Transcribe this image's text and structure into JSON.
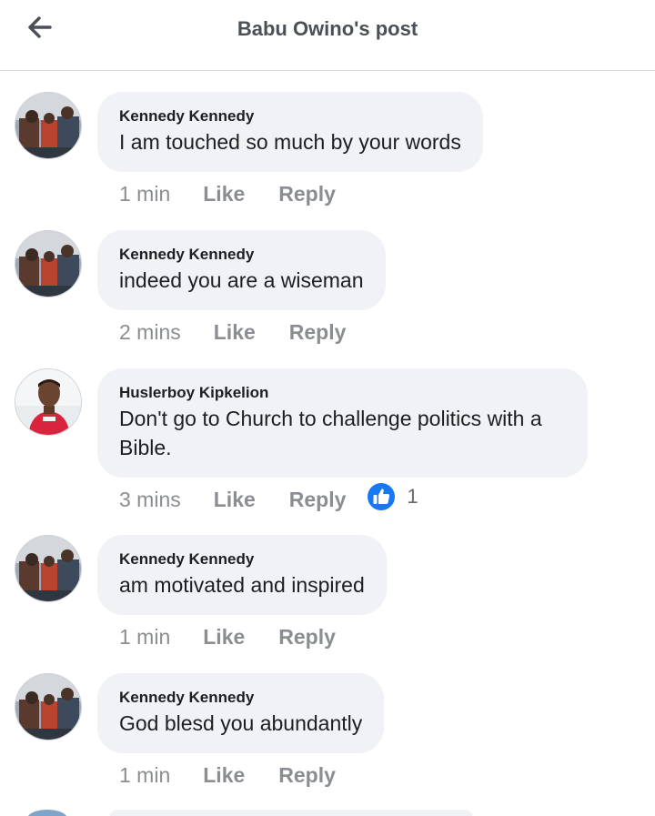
{
  "header": {
    "title": "Babu Owino's post",
    "back_icon": "arrow-left-icon"
  },
  "comments": [
    {
      "author": "Kennedy Kennedy",
      "text": "I am touched so much by your words",
      "time": "1 min",
      "like": "Like",
      "reply": "Reply"
    },
    {
      "author": "Kennedy Kennedy",
      "text": "indeed you are a wiseman",
      "time": "2 mins",
      "like": "Like",
      "reply": "Reply"
    },
    {
      "author": "Huslerboy Kipkelion",
      "text": "Don't go to Church to challenge politics with a Bible.",
      "time": "3 mins",
      "like": "Like",
      "reply": "Reply",
      "reaction_count": "1",
      "reaction_icon": "thumbs-up-icon"
    },
    {
      "author": "Kennedy Kennedy",
      "text": "am motivated and inspired",
      "time": "1 min",
      "like": "Like",
      "reply": "Reply"
    },
    {
      "author": "Kennedy Kennedy",
      "text": "God blesd you abundantly",
      "time": "1 min",
      "like": "Like",
      "reply": "Reply"
    }
  ],
  "colors": {
    "bubble": "#f0f2f5",
    "meta_text": "#8a8d91",
    "like_blue": "#1877f2"
  }
}
